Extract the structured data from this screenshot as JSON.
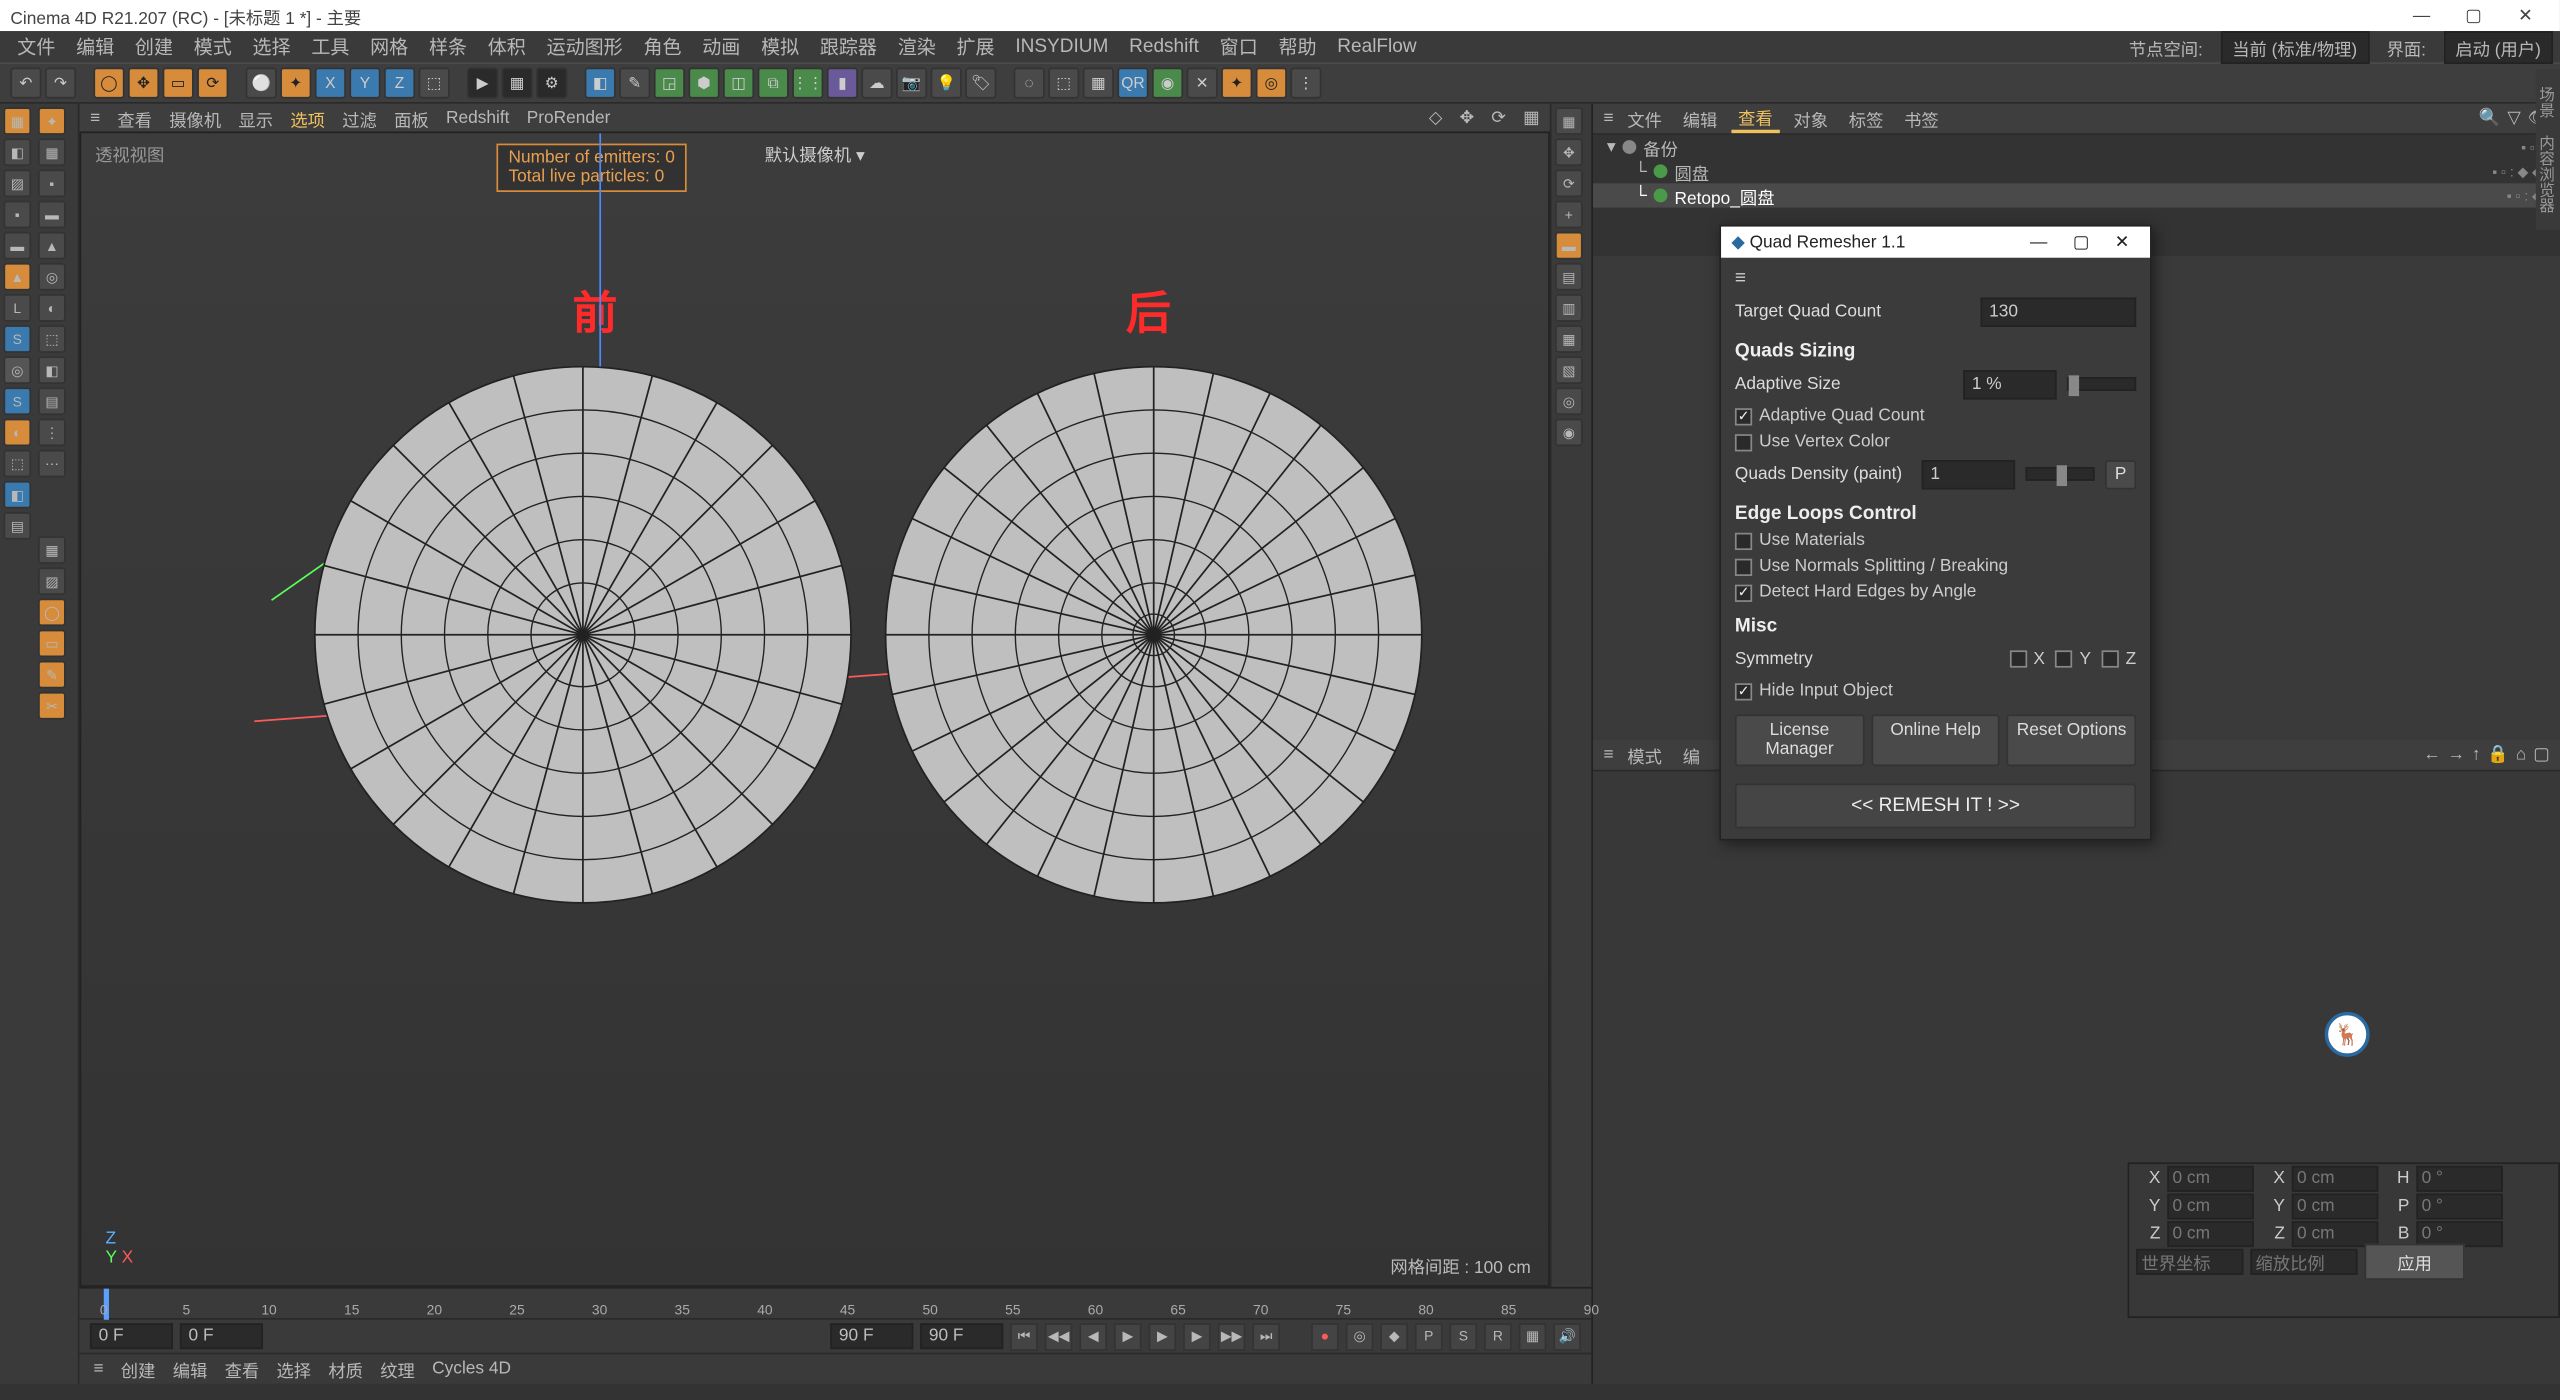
{
  "titlebar": {
    "text": "Cinema 4D R21.207 (RC) - [未标题 1 *] - 主要"
  },
  "menus": [
    "文件",
    "编辑",
    "创建",
    "模式",
    "选择",
    "工具",
    "网格",
    "样条",
    "体积",
    "运动图形",
    "角色",
    "动画",
    "模拟",
    "跟踪器",
    "渲染",
    "扩展",
    "INSYDIUM",
    "Redshift",
    "窗口",
    "帮助",
    "RealFlow"
  ],
  "menubar_right": {
    "nodespace_label": "节点空间:",
    "nodespace_value": "当前 (标准/物理)",
    "layout_label": "界面:",
    "layout_value": "启动 (用户)"
  },
  "viewport": {
    "menus": [
      "查看",
      "摄像机",
      "显示",
      "选项",
      "过滤",
      "面板",
      "Redshift",
      "ProRender"
    ],
    "active_menu": "选项",
    "title": "透视视图",
    "camera": "默认摄像机 ▾",
    "hud_line1": "Number of emitters: 0",
    "hud_line2": "Total live particles: 0",
    "anno_before": "前",
    "anno_after": "后",
    "gridinfo": "网格间距 : 100 cm",
    "axis": {
      "z": "Z",
      "y": "Y",
      "x": "X"
    }
  },
  "timeline": {
    "ticks": [
      0,
      5,
      10,
      15,
      20,
      25,
      30,
      35,
      40,
      45,
      50,
      55,
      60,
      65,
      70,
      75,
      80,
      85,
      90
    ],
    "start": "0 F",
    "start2": "0 F",
    "end": "90 F",
    "end2": "90 F",
    "endlabel": "0 F"
  },
  "tabstrip": [
    "创建",
    "编辑",
    "查看",
    "选择",
    "材质",
    "纹理",
    "Cycles 4D"
  ],
  "coords": {
    "x": "0 cm",
    "y": "0 cm",
    "z": "0 cm",
    "sx": "0 cm",
    "sy": "0 cm",
    "sz": "0 cm",
    "h": "0 °",
    "p": "0 °",
    "b": "0 °",
    "space": "世界坐标",
    "scale": "缩放比例",
    "apply": "应用"
  },
  "obj_manager": {
    "tabs": [
      "文件",
      "编辑",
      "查看",
      "对象",
      "标签",
      "书签"
    ],
    "active": "查看",
    "items": [
      {
        "name": "备份",
        "indent": 0
      },
      {
        "name": "圆盘",
        "indent": 1
      },
      {
        "name": "Retopo_圆盘",
        "indent": 1,
        "selected": true
      }
    ]
  },
  "attr_panel": {
    "tabs": [
      "模式",
      "编"
    ]
  },
  "qr": {
    "title": "Quad Remesher 1.1",
    "target_label": "Target Quad Count",
    "target_value": "130",
    "sizing_header": "Quads Sizing",
    "adaptive_label": "Adaptive Size",
    "adaptive_value": "1 %",
    "adaptive_count": "Adaptive Quad Count",
    "vertex_color": "Use Vertex Color",
    "density_label": "Quads Density (paint)",
    "density_value": "1",
    "density_btn": "P",
    "edge_header": "Edge Loops Control",
    "use_materials": "Use Materials",
    "use_normals": "Use Normals Splitting / Breaking",
    "detect_hard": "Detect Hard Edges by Angle",
    "misc_header": "Misc",
    "symmetry_label": "Symmetry",
    "sym_x": "X",
    "sym_y": "Y",
    "sym_z": "Z",
    "hide_input": "Hide Input Object",
    "btn_license": "License Manager",
    "btn_help": "Online Help",
    "btn_reset": "Reset Options",
    "btn_main": "<<   REMESH IT !   >>"
  },
  "rvtabs": [
    "场景",
    "内容浏览器"
  ]
}
